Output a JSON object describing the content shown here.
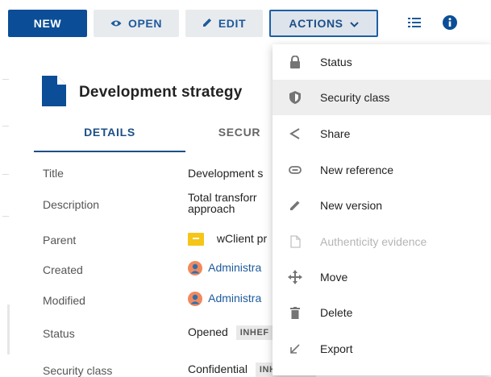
{
  "toolbar": {
    "new_label": "NEW",
    "open_label": "OPEN",
    "edit_label": "EDIT",
    "actions_label": "ACTIONS",
    "primary_color": "#0b4e97"
  },
  "document": {
    "title": "Development strategy"
  },
  "tabs": [
    {
      "label": "DETAILS",
      "active": true
    },
    {
      "label": "SECUR",
      "active": false
    }
  ],
  "fields": {
    "title": {
      "label": "Title",
      "value": "Development s"
    },
    "description": {
      "label": "Description",
      "value_line1": "Total transforr",
      "value_line2": "approach"
    },
    "parent": {
      "label": "Parent",
      "value": "wClient pr"
    },
    "created": {
      "label": "Created",
      "value": "Administra"
    },
    "modified": {
      "label": "Modified",
      "value": "Administra"
    },
    "status": {
      "label": "Status",
      "value": "Opened",
      "badge": "INHEF"
    },
    "security_class": {
      "label": "Security class",
      "value": "Confidential",
      "badge": "INHERITED"
    }
  },
  "menu": {
    "items": [
      {
        "label": "Status",
        "icon": "lock-icon",
        "disabled": false,
        "highlight": false
      },
      {
        "label": "Security class",
        "icon": "shield-icon",
        "disabled": false,
        "highlight": true
      },
      {
        "label": "Share",
        "icon": "share-icon",
        "disabled": false,
        "highlight": false
      },
      {
        "label": "New reference",
        "icon": "link-icon",
        "disabled": false,
        "highlight": false
      },
      {
        "label": "New version",
        "icon": "pencil-icon",
        "disabled": false,
        "highlight": false
      },
      {
        "label": "Authenticity evidence",
        "icon": "document-icon",
        "disabled": true,
        "highlight": false
      },
      {
        "label": "Move",
        "icon": "move-icon",
        "disabled": false,
        "highlight": false
      },
      {
        "label": "Delete",
        "icon": "trash-icon",
        "disabled": false,
        "highlight": false
      },
      {
        "label": "Export",
        "icon": "export-arrow-icon",
        "disabled": false,
        "highlight": false
      }
    ]
  }
}
